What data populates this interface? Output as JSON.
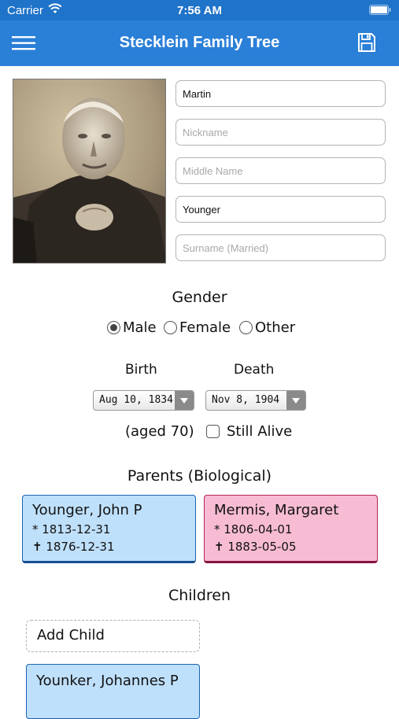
{
  "status_bar": {
    "carrier": "Carrier",
    "time": "7:56 AM",
    "wifi_icon": "wifi-icon",
    "battery_icon": "battery-icon"
  },
  "nav": {
    "title": "Stecklein Family Tree",
    "menu_icon": "hamburger-menu-icon",
    "save_icon": "floppy-disk-save-icon",
    "color": "#2a7fd7"
  },
  "person": {
    "first_name": "Martin",
    "nickname_placeholder": "Nickname",
    "middle_name_placeholder": "Middle Name",
    "surname": "Younger",
    "surname_married_placeholder": "Surname (Married)"
  },
  "gender": {
    "label": "Gender",
    "options": [
      "Male",
      "Female",
      "Other"
    ],
    "selected": "Male"
  },
  "dates": {
    "birth_label": "Birth",
    "death_label": "Death",
    "birth_value": "Aug 10, 1834",
    "death_value": "Nov 8, 1904",
    "aged": "(aged 70)",
    "still_alive_label": "Still Alive",
    "still_alive_checked": false
  },
  "parents": {
    "label": "Parents (Biological)",
    "father": {
      "name": "Younger, John P",
      "birth": "* 1813-12-31",
      "death": "✝ 1876-12-31"
    },
    "mother": {
      "name": "Mermis, Margaret",
      "birth": "* 1806-04-01",
      "death": "✝ 1883-05-05"
    }
  },
  "children": {
    "label": "Children",
    "add_label": "Add Child",
    "items": [
      {
        "name": "Younker, Johannes P"
      }
    ]
  }
}
